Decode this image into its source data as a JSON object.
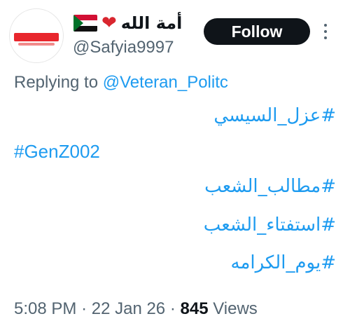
{
  "author": {
    "display_name": "أمة الله",
    "handle": "@Safyia9997",
    "flag_icon": "sudan-flag-icon",
    "heart_icon": "heart-icon"
  },
  "follow_label": "Follow",
  "reply": {
    "prefix": "Replying to",
    "target": "@Veteran_Politc"
  },
  "hashtags": [
    "#عزل_السيسي",
    "#GenZ002",
    "#مطالب_الشعب",
    "#استفتاء_الشعب",
    "#يوم_الكرامه"
  ],
  "meta": {
    "time": "5:08 PM",
    "date": "22 Jan 26",
    "views_count": "845",
    "views_label": "Views"
  },
  "colors": {
    "accent": "#1d9bf0",
    "text": "#0f1419",
    "muted": "#536471"
  }
}
